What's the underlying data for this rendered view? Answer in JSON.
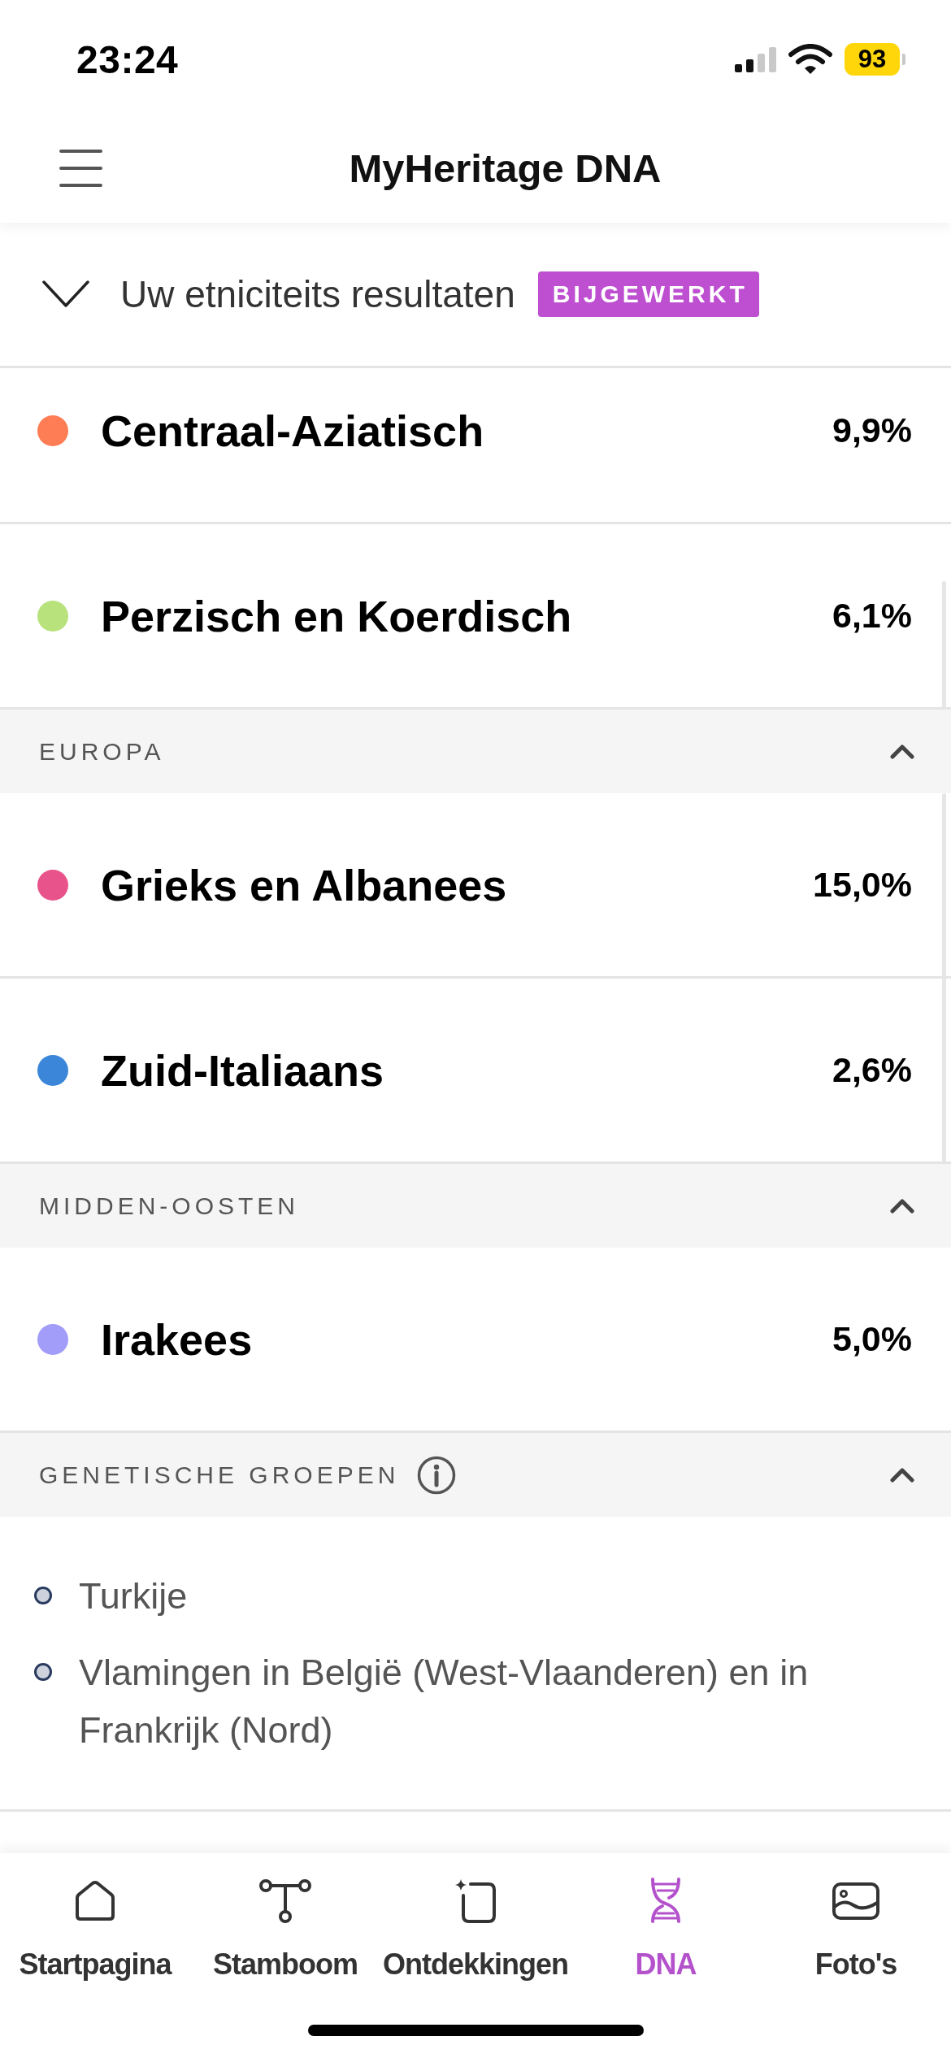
{
  "status_bar": {
    "time": "23:24",
    "battery": "93"
  },
  "header": {
    "title": "MyHeritage DNA"
  },
  "summary": {
    "label": "Uw etniciteits resultaten",
    "badge": "BIJGEWERKT",
    "expanded": false
  },
  "sections": [
    {
      "kind": "ethnicities",
      "rows": [
        {
          "name": "Centraal-Aziatisch",
          "percent": "9,9%",
          "color": "#fe7d55"
        },
        {
          "name": "Perzisch en Koerdisch",
          "percent": "6,1%",
          "color": "#b8e27c"
        }
      ]
    },
    {
      "kind": "ethnicities",
      "title": "EUROPA",
      "expanded": true,
      "rows": [
        {
          "name": "Grieks en Albanees",
          "percent": "15,0%",
          "color": "#e7538a"
        },
        {
          "name": "Zuid-Italiaans",
          "percent": "2,6%",
          "color": "#3b86d9"
        }
      ]
    },
    {
      "kind": "ethnicities",
      "title": "MIDDEN-OOSTEN",
      "expanded": true,
      "rows": [
        {
          "name": "Irakees",
          "percent": "5,0%",
          "color": "#a29df9"
        }
      ]
    },
    {
      "kind": "genetic_groups",
      "title": "GENETISCHE GROEPEN",
      "expanded": true,
      "items": [
        "Turkije",
        "Vlamingen in België (West-Vlaanderen) en in Frankrijk (Nord)"
      ]
    }
  ],
  "bottom_nav": [
    {
      "kind": "home",
      "label": "Startpagina",
      "selected": false
    },
    {
      "kind": "tree",
      "label": "Stamboom",
      "selected": false
    },
    {
      "kind": "discoveries",
      "label": "Ontdekkingen",
      "selected": false
    },
    {
      "kind": "dna",
      "label": "DNA",
      "selected": true
    },
    {
      "kind": "photos",
      "label": "Foto's",
      "selected": false
    }
  ]
}
